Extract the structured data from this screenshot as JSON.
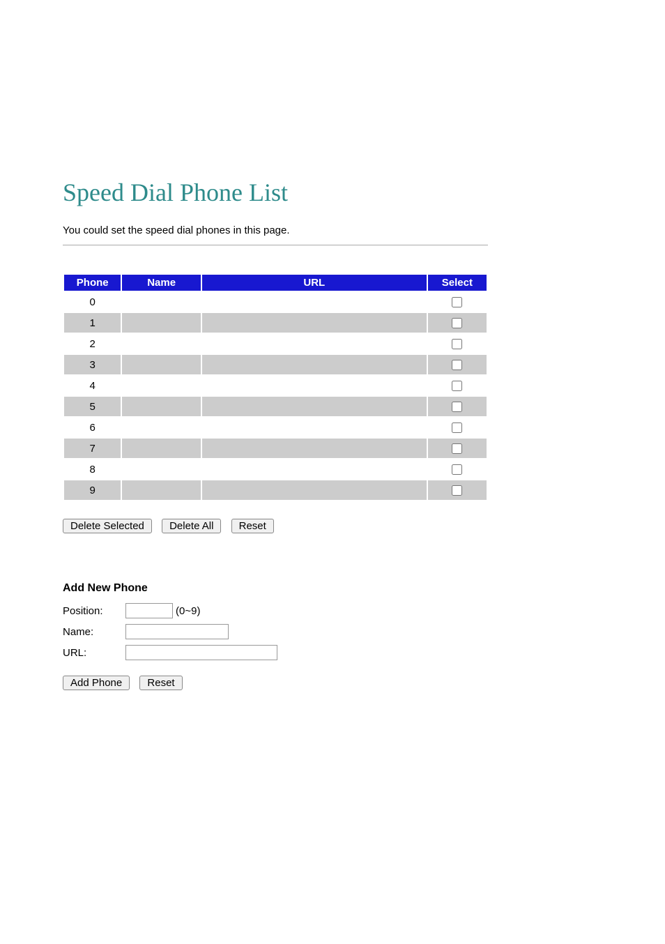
{
  "page": {
    "title": "Speed Dial Phone List",
    "description": "You could set the speed dial phones in this page."
  },
  "table": {
    "headers": {
      "phone": "Phone",
      "name": "Name",
      "url": "URL",
      "select": "Select"
    },
    "rows": [
      {
        "phone": "0",
        "name": "",
        "url": ""
      },
      {
        "phone": "1",
        "name": "",
        "url": ""
      },
      {
        "phone": "2",
        "name": "",
        "url": ""
      },
      {
        "phone": "3",
        "name": "",
        "url": ""
      },
      {
        "phone": "4",
        "name": "",
        "url": ""
      },
      {
        "phone": "5",
        "name": "",
        "url": ""
      },
      {
        "phone": "6",
        "name": "",
        "url": ""
      },
      {
        "phone": "7",
        "name": "",
        "url": ""
      },
      {
        "phone": "8",
        "name": "",
        "url": ""
      },
      {
        "phone": "9",
        "name": "",
        "url": ""
      }
    ]
  },
  "buttons": {
    "delete_selected": "Delete Selected",
    "delete_all": "Delete All",
    "reset_list": "Reset",
    "add_phone": "Add Phone",
    "reset_add": "Reset"
  },
  "add_form": {
    "heading": "Add New Phone",
    "labels": {
      "position": "Position:",
      "name": "Name:",
      "url": "URL:"
    },
    "hints": {
      "position": "(0~9)"
    },
    "values": {
      "position": "",
      "name": "",
      "url": ""
    }
  }
}
